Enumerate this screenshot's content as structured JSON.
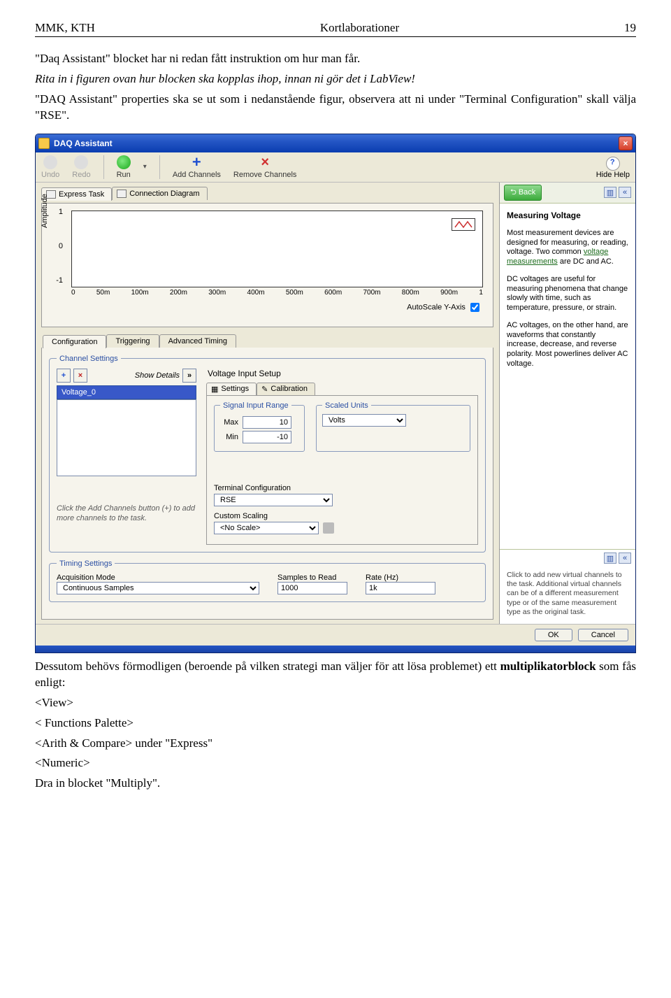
{
  "header": {
    "left": "MMK, KTH",
    "center": "Kortlaborationer",
    "right": "19"
  },
  "intro": {
    "p1": "\"Daq Assistant\" blocket har ni redan fått instruktion om hur man får.",
    "p2": "Rita in i figuren ovan hur blocken ska kopplas ihop, innan ni gör det i LabView!",
    "p3": "\"DAQ Assistant\" properties ska se ut som i nedanstående figur, observera att ni under \"Terminal Configuration\" skall välja \"RSE\"."
  },
  "window": {
    "title": "DAQ Assistant",
    "close": "×",
    "toolbar": {
      "undo": "Undo",
      "redo": "Redo",
      "run": "Run",
      "add": "Add Channels",
      "remove": "Remove Channels",
      "hide_help": "Hide Help"
    },
    "tabs": {
      "express": "Express Task",
      "conn": "Connection Diagram"
    },
    "graph": {
      "ylabel": "Amplitude",
      "yticks": [
        "1",
        "0",
        "-1"
      ],
      "xticks": [
        "0",
        "50m",
        "100m",
        "200m",
        "300m",
        "400m",
        "500m",
        "600m",
        "700m",
        "800m",
        "900m",
        "1"
      ],
      "autoscale": "AutoScale Y-Axis"
    },
    "config": {
      "tabs": {
        "cfg": "Configuration",
        "trig": "Triggering",
        "adv": "Advanced Timing"
      },
      "channel_legend": "Channel Settings",
      "show_details": "Show Details",
      "channel": "Voltage_0",
      "hint": "Click the Add Channels button (+) to add more channels to the task.",
      "setup_title": "Voltage Input Setup",
      "subtabs": {
        "settings": "Settings",
        "cal": "Calibration"
      },
      "range_legend": "Signal Input Range",
      "max_label": "Max",
      "max_val": "10",
      "min_label": "Min",
      "min_val": "-10",
      "units_legend": "Scaled Units",
      "units_val": "Volts",
      "term_label": "Terminal Configuration",
      "term_val": "RSE",
      "scale_label": "Custom Scaling",
      "scale_val": "<No Scale>",
      "timing_legend": "Timing Settings",
      "acq_label": "Acquisition Mode",
      "acq_val": "Continuous Samples",
      "samples_label": "Samples to Read",
      "samples_val": "1000",
      "rate_label": "Rate (Hz)",
      "rate_val": "1k"
    },
    "help": {
      "back": "Back",
      "title": "Measuring Voltage",
      "p1a": "Most measurement devices are designed for measuring, or reading, voltage. Two common ",
      "p1_link1": "voltage measurements",
      "p1b": " are DC and AC.",
      "p2": "DC voltages are useful for measuring phenomena that change slowly with time, such as temperature, pressure, or strain.",
      "p3": "AC voltages, on the other hand, are waveforms that constantly increase, decrease, and reverse polarity. Most powerlines deliver AC voltage.",
      "note": "Click to add new virtual channels to the task. Additional virtual channels can be of a different measurement type or of the same measurement type as the original task."
    },
    "buttons": {
      "ok": "OK",
      "cancel": "Cancel"
    }
  },
  "after": {
    "p1": "Dessutom behövs förmodligen (beroende på vilken strategi man väljer för att lösa problemet) ett multiplikatorblock som fås enligt:",
    "bold": "multiplikatorblock",
    "view": "<View>",
    "fp": "< Functions Palette>",
    "ac": "<Arith & Compare> under \"Express\"",
    "num": "<Numeric>",
    "drag": "Dra in blocket \"Multiply\"."
  }
}
